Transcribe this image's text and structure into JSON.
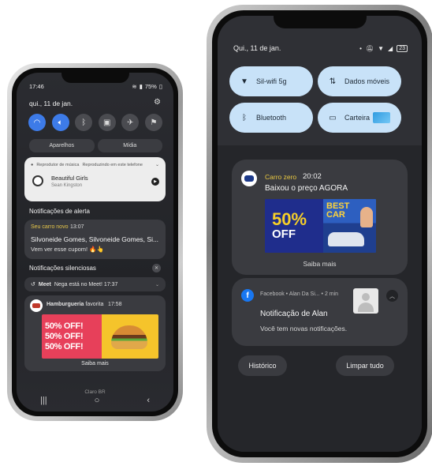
{
  "left_phone": {
    "status": {
      "time": "17:46",
      "battery": "75%"
    },
    "date": "qui., 11 de jan.",
    "quick_toggles": [
      {
        "icon": "wifi-icon",
        "on": true
      },
      {
        "icon": "sound-icon",
        "on": true
      },
      {
        "icon": "bluetooth-icon",
        "on": false
      },
      {
        "icon": "portrait-lock-icon",
        "on": false
      },
      {
        "icon": "airplane-icon",
        "on": false
      },
      {
        "icon": "flashlight-icon",
        "on": false
      }
    ],
    "seg_buttons": [
      "Aparelhos",
      "Mídia"
    ],
    "media": {
      "app": "Reprodutor de música",
      "subtitle": "Reproduzindo em este telefone",
      "song": "Beautiful Girls",
      "artist": "Sean Kingston"
    },
    "alert_section": "Notificações de alerta",
    "alert": {
      "app": "Seu carro novo",
      "time": "13:07",
      "line1": "Silvoneide Gomes, Silvoneide Gomes, Si...",
      "line2": "Vem ver esse cupom! 🔥👆"
    },
    "silent_section": "Notificações silenciosas",
    "meet": {
      "app": "Meet",
      "text": "Nega está no Meet! 17:37"
    },
    "burger": {
      "app": "Hamburgueria",
      "tag": "favorita",
      "time": "17:58",
      "banner_lines": [
        "50% OFF!",
        "50% OFF!",
        "50% OFF!"
      ],
      "link": "Saiba mais"
    },
    "carrier": "Claro BR",
    "nav": [
      "|||",
      "○",
      "‹"
    ]
  },
  "right_phone": {
    "status": {
      "date": "Qui., 11 de jan.",
      "battery": "23"
    },
    "tiles": [
      {
        "icon": "wifi-icon",
        "label": "Sil-wifi 5g"
      },
      {
        "icon": "mobile-data-icon",
        "label": "Dados móveis"
      },
      {
        "icon": "bluetooth-icon",
        "label": "Bluetooth"
      },
      {
        "icon": "wallet-icon",
        "label": "Carteira"
      }
    ],
    "notif_car": {
      "app": "Carro zero",
      "time": "20:02",
      "message": "Baixou o preço  AGORA",
      "banner_pct": "50%",
      "banner_off": "OFF",
      "banner_best": "BEST",
      "banner_car": "CAR",
      "link": "Saiba mais"
    },
    "notif_fb": {
      "meta": "Facebook • Alan Da Si... • 2 min",
      "title": "Notificação de Alan",
      "body": "Você tem novas notificações."
    },
    "buttons": {
      "history": "Histórico",
      "clear": "Limpar tudo"
    },
    "accent": "#c8e2f8"
  }
}
